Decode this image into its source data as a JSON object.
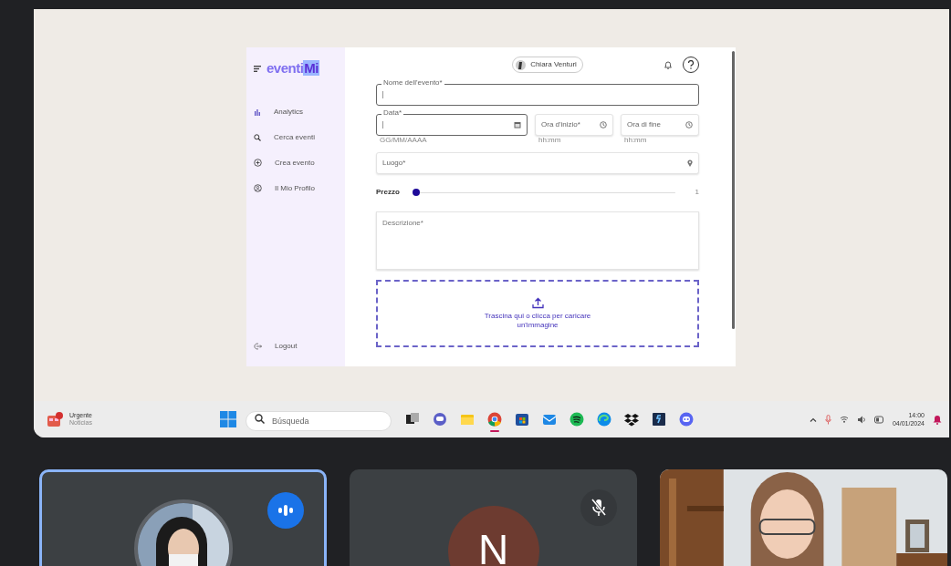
{
  "shared_screen": {
    "app": {
      "logo": {
        "text": "eventi",
        "accent": "Mi"
      },
      "sidebar": {
        "items": [
          {
            "label": "Analytics"
          },
          {
            "label": "Cerca eventi"
          },
          {
            "label": "Crea evento"
          },
          {
            "label": "Il Mio Profilo"
          }
        ],
        "logout": "Logout"
      },
      "user_chip": "Chiara Venturi",
      "form": {
        "rows": [
          [
            {
              "kind": "text",
              "label": "Nome dell'evento*"
            }
          ],
          [
            {
              "kind": "date",
              "label": "Data*",
              "helper": "GG/MM/AAAA"
            },
            {
              "kind": "time",
              "label": "Ora d'inizio*",
              "helper": "hh:mm"
            },
            {
              "kind": "time",
              "label": "Ora di fine",
              "helper": "hh:mm"
            }
          ],
          [
            {
              "kind": "place",
              "label": "Luogo*"
            }
          ]
        ],
        "price": {
          "label": "Prezzo",
          "level": 0,
          "reading": "1"
        },
        "description": "Descrizione*",
        "dropzone": "Trascina qui o clicca per caricare un'immagine"
      }
    },
    "taskbar": {
      "news": {
        "title": "Urgente",
        "subtitle": "Noticias"
      },
      "search": {
        "placeholder": "Búsqueda"
      },
      "apps": [
        {
          "kind": "taskview",
          "active": false
        },
        {
          "kind": "chat",
          "active": false
        },
        {
          "kind": "folder",
          "active": false
        },
        {
          "kind": "chrome",
          "active": true
        },
        {
          "kind": "store",
          "active": false
        },
        {
          "kind": "mail",
          "active": false
        },
        {
          "kind": "music",
          "active": false
        },
        {
          "kind": "edge",
          "active": false
        },
        {
          "kind": "dropbox",
          "active": false
        },
        {
          "kind": "editor",
          "active": false
        },
        {
          "kind": "discord",
          "active": false
        }
      ],
      "time": "14:00",
      "date": "04/01/2024"
    }
  },
  "participants": [
    {
      "kind": "avatar",
      "speaking": true,
      "muted": false
    },
    {
      "kind": "letter",
      "initial": "N",
      "speaking": false,
      "muted": true
    },
    {
      "kind": "video",
      "speaking": false,
      "muted": false
    }
  ]
}
